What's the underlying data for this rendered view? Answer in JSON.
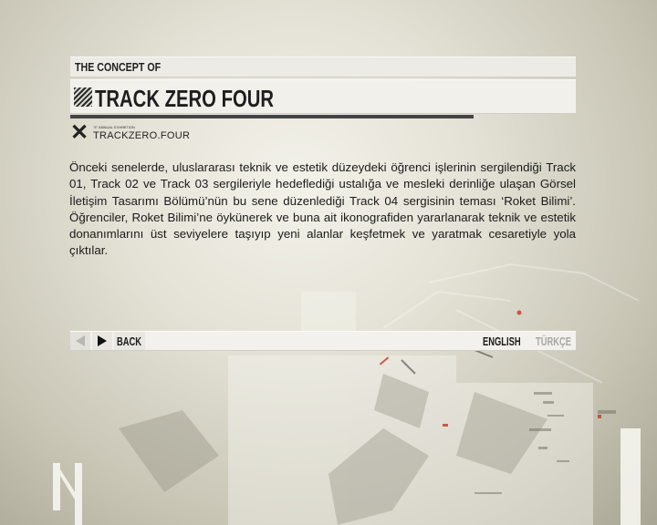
{
  "header": {
    "concept_label": "THE CONCEPT OF",
    "title": "TRACK ZERO FOUR"
  },
  "logo": {
    "name": "TRACKZERO.FOUR",
    "small_text": "\"4\" ANNUAL EXHIBITION"
  },
  "body": {
    "paragraph": "Önceki senelerde, uluslararası teknik ve estetik düzeydeki öğrenci işlerinin sergilendiği Track 01, Track 02 ve Track 03 sergileriyle hedeflediği ustalığa ve mesleki derinliğe ulaşan Görsel İletişim Tasarımı Bölümü’nün bu sene düzenlediği Track 04 sergisinin teması ‘Roket Bilimi’. Öğrenciler, Roket Bilimi’ne öykünerek ve buna ait ikonografiden yararlanarak  teknik ve estetik donanımlarını üst seviyelere taşıyıp yeni alanlar keşfetmek ve yaratmak cesaretiyle yola çıktılar."
  },
  "nav": {
    "back_label": "BACK",
    "lang_english": "ENGLISH",
    "lang_turkish": "TÜRKÇE",
    "prev_icon": "arrow-left-icon",
    "next_icon": "arrow-right-icon"
  },
  "colors": {
    "background": "#e4e2d6",
    "band": "#f1f0eb",
    "text": "#1a1a1a",
    "inactive": "#a8a7a2",
    "accent_red": "#c0392b"
  }
}
